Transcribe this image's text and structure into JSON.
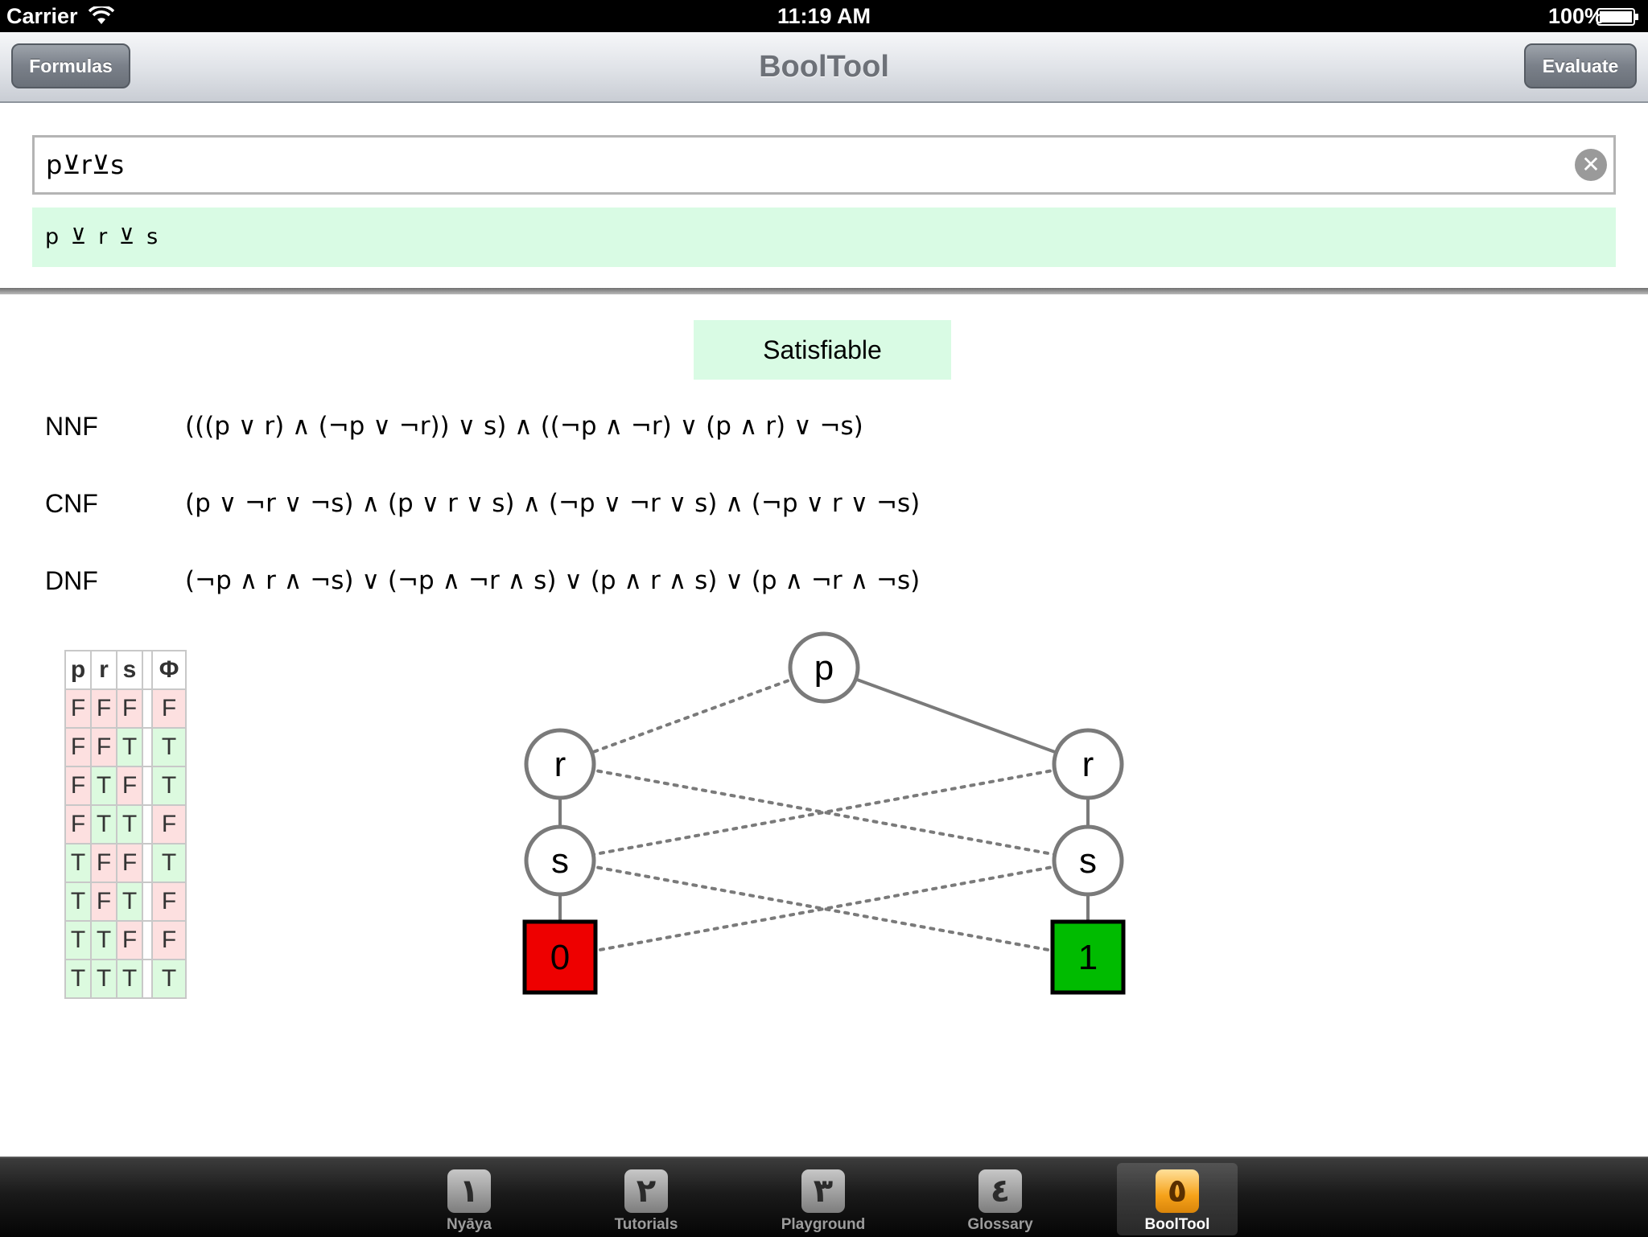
{
  "status_bar": {
    "carrier": "Carrier",
    "time": "11:19 AM",
    "battery": "100%",
    "wifi_icon": "wifi-icon",
    "battery_icon": "battery-icon"
  },
  "nav": {
    "left_button": "Formulas",
    "title": "BoolTool",
    "right_button": "Evaluate"
  },
  "formula": {
    "input_value": "p⊻r⊻s",
    "parsed": "p ⊻ r ⊻ s",
    "clear_icon": "clear-icon"
  },
  "result": {
    "status": "Satisfiable",
    "status_color": "#d9fbe4"
  },
  "normal_forms": [
    {
      "label": "NNF",
      "value": "(((p ∨ r) ∧ (¬p ∨ ¬r)) ∨ s) ∧ ((¬p ∧ ¬r) ∨ (p ∧ r) ∨ ¬s)"
    },
    {
      "label": "CNF",
      "value": "(p ∨ ¬r ∨ ¬s) ∧ (p ∨ r ∨ s) ∧ (¬p ∨ ¬r ∨ s) ∧ (¬p ∨ r ∨ ¬s)"
    },
    {
      "label": "DNF",
      "value": "(¬p ∧ r ∧ ¬s) ∨ (¬p ∧ ¬r ∧ s) ∨ (p ∧ r ∧ s) ∨ (p ∧ ¬r ∧ ¬s)"
    }
  ],
  "truth_table": {
    "headers": [
      "p",
      "r",
      "s",
      "Φ"
    ],
    "rows": [
      [
        "F",
        "F",
        "F",
        "F"
      ],
      [
        "F",
        "F",
        "T",
        "T"
      ],
      [
        "F",
        "T",
        "F",
        "T"
      ],
      [
        "F",
        "T",
        "T",
        "F"
      ],
      [
        "T",
        "F",
        "F",
        "T"
      ],
      [
        "T",
        "F",
        "T",
        "F"
      ],
      [
        "T",
        "T",
        "F",
        "F"
      ],
      [
        "T",
        "T",
        "T",
        "T"
      ]
    ],
    "true_color": "#dcfadf",
    "false_color": "#fde0e0"
  },
  "bdd": {
    "nodes": [
      {
        "id": "p",
        "label": "p"
      },
      {
        "id": "rL",
        "label": "r"
      },
      {
        "id": "rR",
        "label": "r"
      },
      {
        "id": "sL",
        "label": "s"
      },
      {
        "id": "sR",
        "label": "s"
      },
      {
        "id": "t0",
        "label": "0",
        "terminal": true,
        "color": "#ee0000"
      },
      {
        "id": "t1",
        "label": "1",
        "terminal": true,
        "color": "#00bb00"
      }
    ],
    "edges": [
      {
        "from": "p",
        "to": "rL",
        "style": "dotted"
      },
      {
        "from": "p",
        "to": "rR",
        "style": "solid"
      },
      {
        "from": "rL",
        "to": "sL",
        "style": "solid"
      },
      {
        "from": "rL",
        "to": "sR",
        "style": "dotted"
      },
      {
        "from": "rR",
        "to": "sR",
        "style": "solid"
      },
      {
        "from": "rR",
        "to": "sL",
        "style": "dotted"
      },
      {
        "from": "sL",
        "to": "t0",
        "style": "solid"
      },
      {
        "from": "sL",
        "to": "t1",
        "style": "dotted"
      },
      {
        "from": "sR",
        "to": "t1",
        "style": "solid"
      },
      {
        "from": "sR",
        "to": "t0",
        "style": "dotted"
      }
    ]
  },
  "tabs": [
    {
      "label": "Nyāya",
      "icon_glyph": "١",
      "selected": false
    },
    {
      "label": "Tutorials",
      "icon_glyph": "٢",
      "selected": false
    },
    {
      "label": "Playground",
      "icon_glyph": "٣",
      "selected": false
    },
    {
      "label": "Glossary",
      "icon_glyph": "٤",
      "selected": false
    },
    {
      "label": "BoolTool",
      "icon_glyph": "٥",
      "selected": true
    }
  ]
}
